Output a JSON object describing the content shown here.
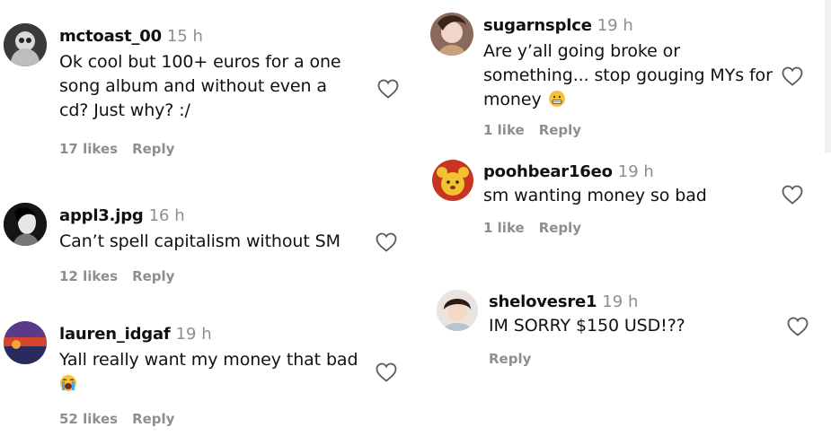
{
  "comments": [
    {
      "username": "mctoast_00",
      "time": "15 h",
      "lines": [
        "Ok cool but 100+ euros for a one",
        "song album and without even a",
        "cd? Just why? :/"
      ],
      "likes": "17 likes",
      "reply": "Reply"
    },
    {
      "username": "appl3.jpg",
      "time": "16 h",
      "lines": [
        "Can’t spell capitalism without SM"
      ],
      "likes": "12 likes",
      "reply": "Reply"
    },
    {
      "username": "lauren_idgaf",
      "time": "19 h",
      "lines": [
        "Yall really want my money that bad"
      ],
      "likes": "52 likes",
      "reply": "Reply"
    },
    {
      "username": "sugarnsplce",
      "time": "19 h",
      "lines": [
        "Are y’all going broke or",
        "something... stop gouging MYs for",
        "money"
      ],
      "likes": "1 like",
      "reply": "Reply"
    },
    {
      "username": "poohbear16eo",
      "time": "19 h",
      "lines": [
        "sm wanting money so bad"
      ],
      "likes": "1 like",
      "reply": "Reply"
    },
    {
      "username": "shelovesre1",
      "time": "19 h",
      "lines": [
        "IM SORRY $150 USD!??"
      ],
      "reply": "Reply"
    }
  ],
  "icons": {
    "like": "heart-outline-icon",
    "emoji_crying": "loudly-crying-face-icon",
    "emoji_grimace": "grimacing-face-icon"
  },
  "colors": {
    "muted": "#8e8e8e",
    "text": "#111111"
  }
}
